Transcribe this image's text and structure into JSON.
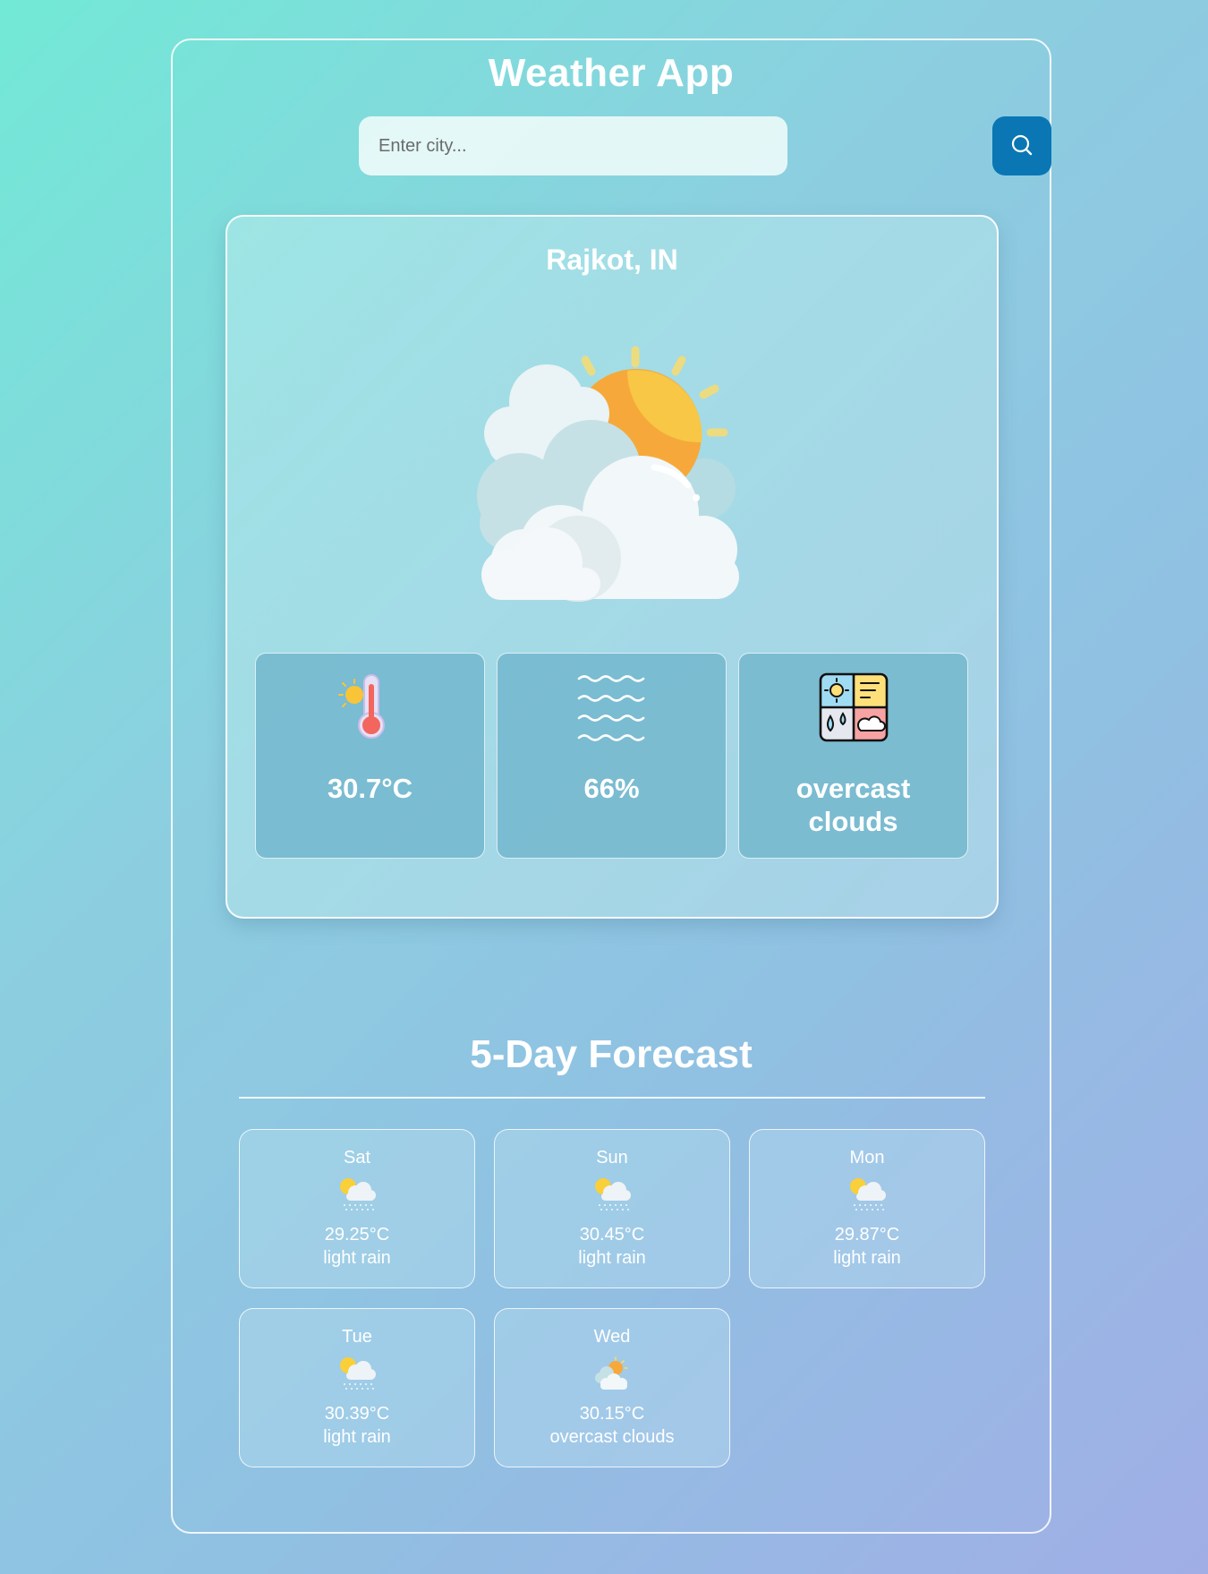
{
  "app": {
    "title": "Weather App"
  },
  "search": {
    "placeholder": "Enter city...",
    "value": "",
    "button_icon": "search-icon"
  },
  "current": {
    "city": "Rajkot, IN",
    "condition_icon": "partly-cloudy-icon",
    "temperature": "30.7°C",
    "temperature_icon": "thermometer-icon",
    "humidity": "66%",
    "humidity_icon": "humidity-waves-icon",
    "description": "overcast clouds",
    "description_icon": "weather-conditions-icon"
  },
  "forecast": {
    "title": "5-Day Forecast",
    "days": [
      {
        "day": "Sat",
        "temp": "29.25°C",
        "desc": "light rain",
        "icon": "light-rain-icon"
      },
      {
        "day": "Sun",
        "temp": "30.45°C",
        "desc": "light rain",
        "icon": "light-rain-icon"
      },
      {
        "day": "Mon",
        "temp": "29.87°C",
        "desc": "light rain",
        "icon": "light-rain-icon"
      },
      {
        "day": "Tue",
        "temp": "30.39°C",
        "desc": "light rain",
        "icon": "light-rain-icon"
      },
      {
        "day": "Wed",
        "temp": "30.15°C",
        "desc": "overcast clouds",
        "icon": "overcast-clouds-icon"
      }
    ]
  },
  "colors": {
    "search_button": "#0a77b4",
    "stat_box": "#78bad0",
    "sun": "#f7b13a",
    "thermometer": "#f2665e"
  }
}
